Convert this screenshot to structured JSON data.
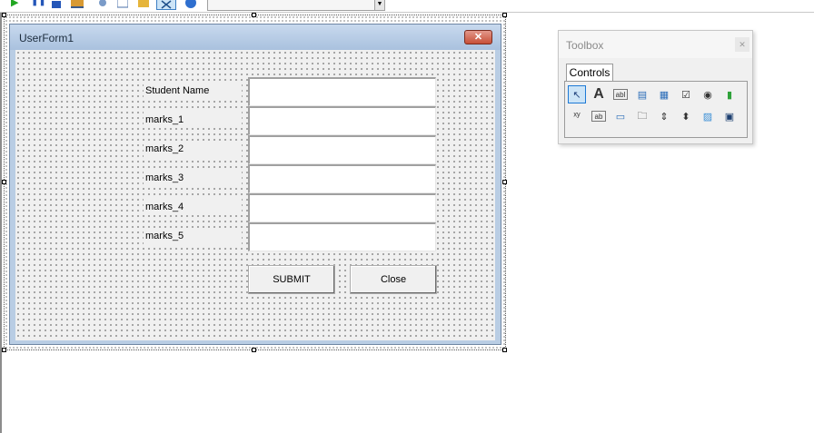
{
  "toolbar": {
    "icons": [
      "run-icon",
      "pause-icon",
      "stop-icon",
      "design-mode-icon",
      "project-explorer-icon",
      "properties-icon",
      "object-browser-icon",
      "toolbox-toggle-icon",
      "help-icon"
    ],
    "dropdown_value": ""
  },
  "userform": {
    "title": "UserForm1",
    "close_glyph": "✕",
    "labels": [
      "Student Name",
      "marks_1",
      "marks_2",
      "marks_3",
      "marks_4",
      "marks_5"
    ],
    "textbox_values": [
      "",
      "",
      "",
      "",
      "",
      ""
    ],
    "submit_label": "SUBMIT",
    "close_label": "Close"
  },
  "toolbox": {
    "title": "Toolbox",
    "close_glyph": "✕",
    "tab_label": "Controls",
    "tools": [
      {
        "icon": "pointer-icon",
        "glyph": "↖"
      },
      {
        "icon": "label-icon",
        "glyph": "A"
      },
      {
        "icon": "textbox-icon",
        "glyph": "abl"
      },
      {
        "icon": "combobox-icon",
        "glyph": "▤"
      },
      {
        "icon": "listbox-icon",
        "glyph": "▦"
      },
      {
        "icon": "checkbox-icon",
        "glyph": "☑"
      },
      {
        "icon": "optionbutton-icon",
        "glyph": "◉"
      },
      {
        "icon": "togglebutton-icon",
        "glyph": "▮"
      },
      {
        "icon": "frame-icon",
        "glyph": "ˣʸ"
      },
      {
        "icon": "commandbutton-icon",
        "glyph": "ab"
      },
      {
        "icon": "tabstrip-icon",
        "glyph": "▭"
      },
      {
        "icon": "multipage-icon",
        "glyph": "🗀"
      },
      {
        "icon": "scrollbar-icon",
        "glyph": "⇕"
      },
      {
        "icon": "spinbutton-icon",
        "glyph": "⬍"
      },
      {
        "icon": "image-icon",
        "glyph": "▨"
      },
      {
        "icon": "refedit-icon",
        "glyph": "▣"
      }
    ]
  },
  "colors": {
    "form_frame": "#b9cde4",
    "close_button": "#c75038",
    "selected_tool": "#cce4f7"
  }
}
